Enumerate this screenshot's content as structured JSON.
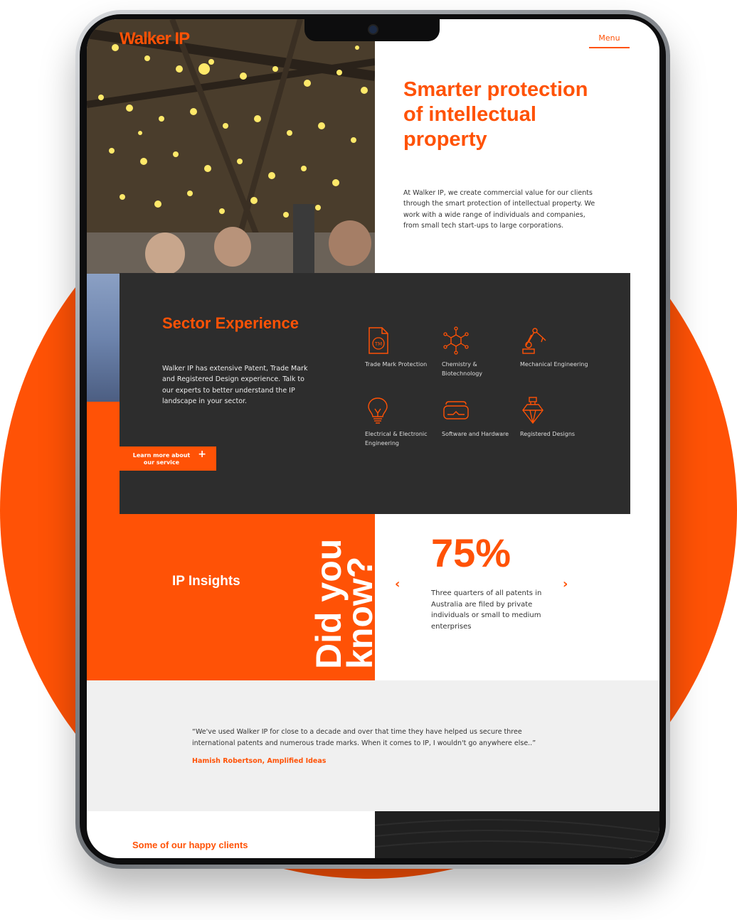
{
  "brand": {
    "logo": "Walker IP",
    "accent": "#ff5206"
  },
  "nav": {
    "menu_label": "Menu"
  },
  "hero": {
    "title": "Smarter protection of intellectual property",
    "body": "At Walker IP, we create commercial value for our clients through the smart protection of intellectual property. We work with a wide range of individuals and companies, from small tech start-ups to large corporations."
  },
  "sector": {
    "title": "Sector Experience",
    "body": "Walker IP has extensive Patent, Trade Mark and Registered Design experience. Talk to our experts to better understand the IP landscape in your sector.",
    "cta": "Learn more about our service",
    "cta_icon": "+",
    "items": [
      {
        "label": "Trade Mark Protection",
        "icon": "trademark-document-icon"
      },
      {
        "label": "Chemistry & Biotechnology",
        "icon": "molecule-icon"
      },
      {
        "label": "Mechanical Engineering",
        "icon": "robot-arm-icon"
      },
      {
        "label": "Electrical & Electronic Engineering",
        "icon": "lightbulb-icon"
      },
      {
        "label": "Software and Hardware",
        "icon": "vr-headset-icon"
      },
      {
        "label": "Registered Designs",
        "icon": "perfume-bottle-icon"
      }
    ]
  },
  "insights": {
    "title": "IP Insights",
    "banner_line1": "Did you",
    "banner_line2": "know?",
    "stat_value": "75%",
    "stat_text": "Three quarters of all patents in Australia are filed by private individuals or small to medium enterprises",
    "prev": "‹",
    "next": "›"
  },
  "testimonial": {
    "quote": "“We've used Walker IP for close to a decade and over that time they have helped us secure three international patents and numerous trade marks. When it comes to IP, I wouldn't go anywhere else..”",
    "author": "Hamish Robertson, Amplified Ideas"
  },
  "clients": {
    "title": "Some of our happy clients"
  }
}
